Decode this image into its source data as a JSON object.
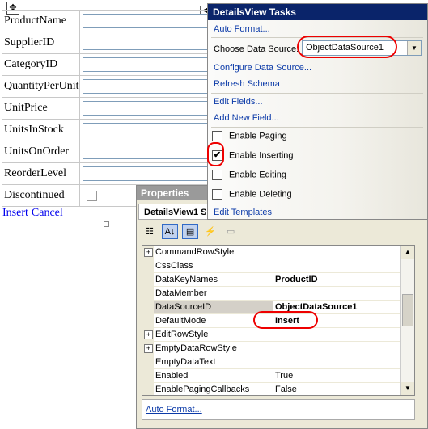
{
  "designer": {
    "fields": [
      {
        "label": "ProductName",
        "type": "textbox"
      },
      {
        "label": "SupplierID",
        "type": "textbox"
      },
      {
        "label": "CategoryID",
        "type": "textbox"
      },
      {
        "label": "QuantityPerUnit",
        "type": "textbox"
      },
      {
        "label": "UnitPrice",
        "type": "textbox"
      },
      {
        "label": "UnitsInStock",
        "type": "textbox"
      },
      {
        "label": "UnitsOnOrder",
        "type": "textbox"
      },
      {
        "label": "ReorderLevel",
        "type": "textbox"
      },
      {
        "label": "Discontinued",
        "type": "checkbox"
      }
    ],
    "insert_link": "Insert",
    "cancel_link": "Cancel",
    "move_icon": "move-cross-icon",
    "smart_tag_icon": "smart-tag-arrow-icon"
  },
  "tasks": {
    "title": "DetailsView Tasks",
    "auto_format": "Auto Format...",
    "choose_ds_label": "Choose Data Source:",
    "choose_ds_value": "ObjectDataSource1",
    "configure_ds": "Configure Data Source...",
    "refresh_schema": "Refresh Schema",
    "edit_fields": "Edit Fields...",
    "add_new_field": "Add New Field...",
    "enable_paging": {
      "label": "Enable Paging",
      "checked": false
    },
    "enable_inserting": {
      "label": "Enable Inserting",
      "checked": true
    },
    "enable_editing": {
      "label": "Enable Editing",
      "checked": false
    },
    "enable_deleting": {
      "label": "Enable Deleting",
      "checked": false
    },
    "edit_templates": "Edit Templates",
    "highlight_color": "#e00000"
  },
  "properties": {
    "title": "Properties",
    "object_name": "DetailsView1  S",
    "toolbar_icons": [
      "categorized-icon",
      "alphabetical-icon",
      "properties-icon",
      "events-icon",
      "property-pages-icon"
    ],
    "rows": [
      {
        "name": "CommandRowStyle",
        "value": "",
        "expandable": true,
        "bold": false
      },
      {
        "name": "CssClass",
        "value": "",
        "expandable": false,
        "bold": false
      },
      {
        "name": "DataKeyNames",
        "value": "ProductID",
        "expandable": false,
        "bold": true
      },
      {
        "name": "DataMember",
        "value": "",
        "expandable": false,
        "bold": false
      },
      {
        "name": "DataSourceID",
        "value": "ObjectDataSource1",
        "expandable": false,
        "bold": true,
        "selected": true
      },
      {
        "name": "DefaultMode",
        "value": "Insert",
        "expandable": false,
        "bold": true
      },
      {
        "name": "EditRowStyle",
        "value": "",
        "expandable": true,
        "bold": false
      },
      {
        "name": "EmptyDataRowStyle",
        "value": "",
        "expandable": true,
        "bold": false
      },
      {
        "name": "EmptyDataText",
        "value": "",
        "expandable": false,
        "bold": false
      },
      {
        "name": "Enabled",
        "value": "True",
        "expandable": false,
        "bold": false
      },
      {
        "name": "EnablePagingCallbacks",
        "value": "False",
        "expandable": false,
        "bold": false
      }
    ],
    "footer_link": "Auto Format..."
  }
}
